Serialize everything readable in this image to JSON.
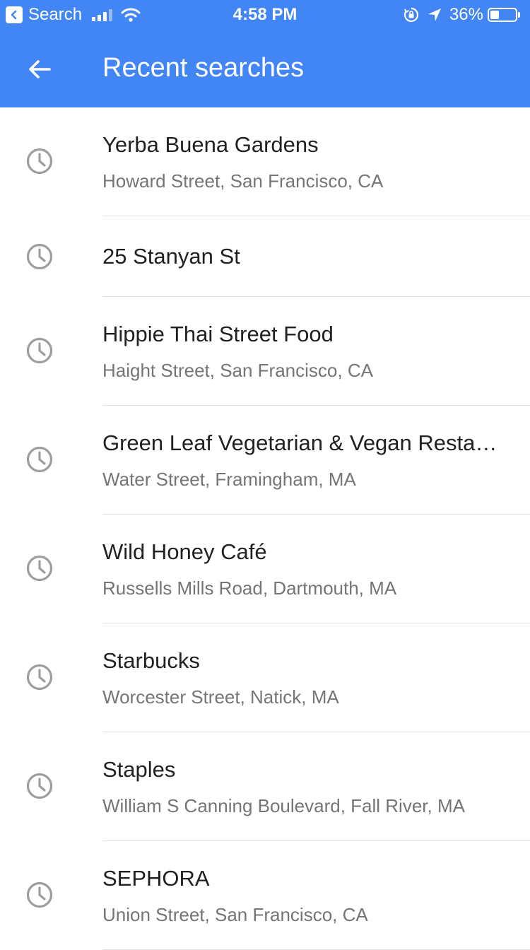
{
  "status_bar": {
    "back_app": "Search",
    "time": "4:58 PM",
    "battery_percent": "36%",
    "battery_level": 0.36,
    "icons": [
      "back-app-icon",
      "signal-icon",
      "wifi-icon",
      "orientation-lock-icon",
      "location-arrow-icon",
      "battery-icon"
    ]
  },
  "header": {
    "title": "Recent searches",
    "back_icon": "arrow-left-icon",
    "color": "#4285f4"
  },
  "recent_searches": [
    {
      "title": "Yerba Buena Gardens",
      "subtitle": "Howard Street, San Francisco, CA"
    },
    {
      "title": "25 Stanyan St",
      "subtitle": ""
    },
    {
      "title": "Hippie Thai Street Food",
      "subtitle": "Haight Street, San Francisco, CA"
    },
    {
      "title": "Green Leaf Vegetarian & Vegan Restaurant",
      "subtitle": "Water Street, Framingham, MA"
    },
    {
      "title": "Wild Honey Café",
      "subtitle": "Russells Mills Road, Dartmouth, MA"
    },
    {
      "title": "Starbucks",
      "subtitle": "Worcester Street, Natick, MA"
    },
    {
      "title": "Staples",
      "subtitle": "William S Canning Boulevard, Fall River, MA"
    },
    {
      "title": "SEPHORA",
      "subtitle": "Union Street, San Francisco, CA"
    }
  ],
  "colors": {
    "title_text": "#212121",
    "subtitle_text": "#757575",
    "icon": "#9e9e9e",
    "divider": "#e0e0e0"
  }
}
